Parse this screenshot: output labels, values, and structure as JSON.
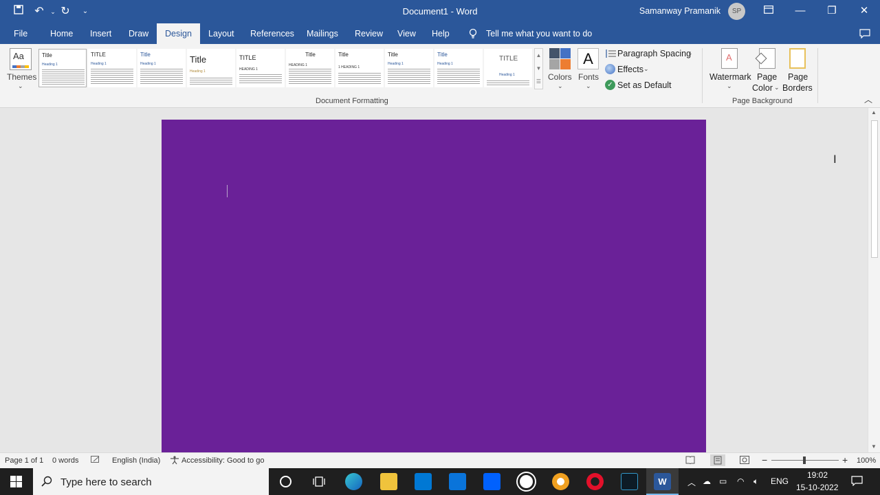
{
  "titlebar": {
    "doc_title": "Document1  -  Word",
    "user_name": "Samanway Pramanik",
    "avatar_initials": "SP"
  },
  "tabs": [
    "File",
    "Home",
    "Insert",
    "Draw",
    "Design",
    "Layout",
    "References",
    "Mailings",
    "Review",
    "View",
    "Help"
  ],
  "active_tab": "Design",
  "tell_me": "Tell me what you want to do",
  "ribbon": {
    "themes_label": "Themes",
    "style_set_titles": [
      "Title",
      "TITLE",
      "Title",
      "Title",
      "TITLE",
      "Title",
      "Title",
      "Title",
      "Title",
      "TITLE"
    ],
    "colors_label": "Colors",
    "fonts_label": "Fonts",
    "paragraph_spacing": "Paragraph Spacing",
    "effects": "Effects",
    "set_as_default": "Set as Default",
    "group_document_formatting": "Document Formatting",
    "watermark": "Watermark",
    "page_color_line1": "Page",
    "page_color_line2": "Color",
    "page_borders_line1": "Page",
    "page_borders_line2": "Borders",
    "group_page_background": "Page Background"
  },
  "page_color": "#6a2198",
  "status": {
    "page": "Page 1 of 1",
    "words": "0 words",
    "language": "English (India)",
    "accessibility": "Accessibility: Good to go",
    "zoom": "100%"
  },
  "taskbar": {
    "search_placeholder": "Type here to search",
    "language": "ENG",
    "time": "19:02",
    "date": "15-10-2022"
  }
}
